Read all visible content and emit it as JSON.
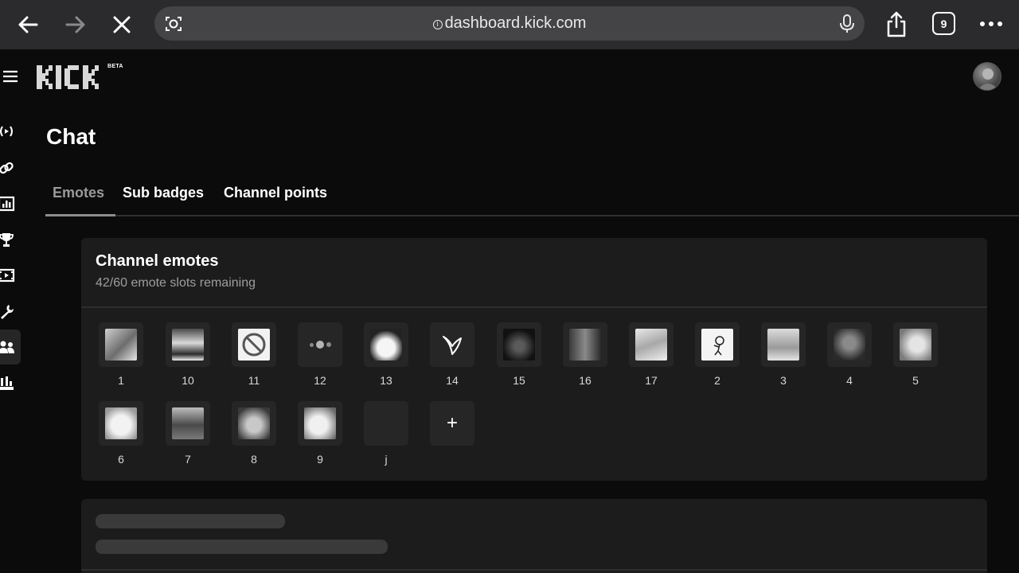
{
  "browser": {
    "url": "dashboard.kick.com",
    "tab_count": "9"
  },
  "brand": {
    "logo_text": "KICK",
    "beta_label": "BETA"
  },
  "page": {
    "title": "Chat"
  },
  "tabs": [
    {
      "label": "Emotes",
      "active": true
    },
    {
      "label": "Sub badges",
      "active": false
    },
    {
      "label": "Channel points",
      "active": false
    }
  ],
  "channel_emotes": {
    "title": "Channel emotes",
    "slots_text": "42/60 emote slots remaining",
    "emotes": [
      {
        "label": "1"
      },
      {
        "label": "10"
      },
      {
        "label": "11"
      },
      {
        "label": "12"
      },
      {
        "label": "13"
      },
      {
        "label": "14"
      },
      {
        "label": "15"
      },
      {
        "label": "16"
      },
      {
        "label": "17"
      },
      {
        "label": "2"
      },
      {
        "label": "3"
      },
      {
        "label": "4"
      },
      {
        "label": "5"
      },
      {
        "label": "6"
      },
      {
        "label": "7"
      },
      {
        "label": "8"
      },
      {
        "label": "9"
      },
      {
        "label": "j"
      }
    ],
    "add_label": "+"
  },
  "colors": {
    "background": "#0b0b0b",
    "card": "#1c1c1c",
    "tile": "#262626",
    "browser_bar": "#2b2b2d"
  }
}
